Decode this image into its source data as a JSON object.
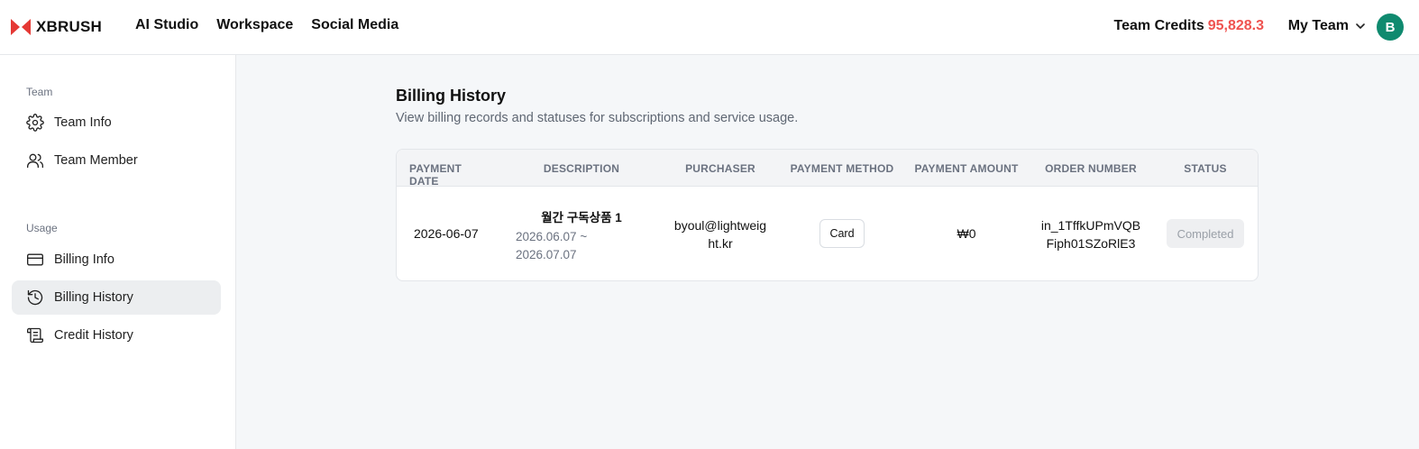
{
  "app": {
    "logo": "XBRUSH",
    "nav": [
      "AI Studio",
      "Workspace",
      "Social Media"
    ],
    "credits_label": "Team Credits",
    "credits_value": "95,828.3",
    "team_name": "My Team",
    "avatar_initial": "B"
  },
  "sidebar": {
    "sections": [
      {
        "label": "Team",
        "items": [
          {
            "label": "Team Info",
            "icon": "gear-icon"
          },
          {
            "label": "Team Member",
            "icon": "users-icon"
          }
        ]
      },
      {
        "label": "Usage",
        "items": [
          {
            "label": "Billing Info",
            "icon": "credit-card-icon"
          },
          {
            "label": "Billing History",
            "icon": "history-icon",
            "active": true
          },
          {
            "label": "Credit History",
            "icon": "scroll-icon"
          }
        ]
      }
    ]
  },
  "page": {
    "title": "Billing History",
    "subtitle": "View billing records and statuses for subscriptions and service usage."
  },
  "table": {
    "columns": [
      "PAYMENT DATE",
      "DESCRIPTION",
      "PURCHASER",
      "PAYMENT METHOD",
      "PAYMENT AMOUNT",
      "ORDER NUMBER",
      "STATUS"
    ],
    "rows": [
      {
        "payment_date": "2026-06-07",
        "description_title": "월간 구독상품 1",
        "description_range_line1": "2026.06.07 ~",
        "description_range_line2": "2026.07.07",
        "purchaser_line1": "byoul@lightweig",
        "purchaser_line2": "ht.kr",
        "payment_method": "Card",
        "payment_amount": "₩0",
        "order_number_line1": "in_1TffkUPmVQB",
        "order_number_line2": "Fiph01SZoRlE3",
        "status": "Completed"
      }
    ]
  },
  "colors": {
    "accent_red": "#ef5350",
    "avatar_bg": "#0f8a6f",
    "logo_red": "#e53935"
  }
}
